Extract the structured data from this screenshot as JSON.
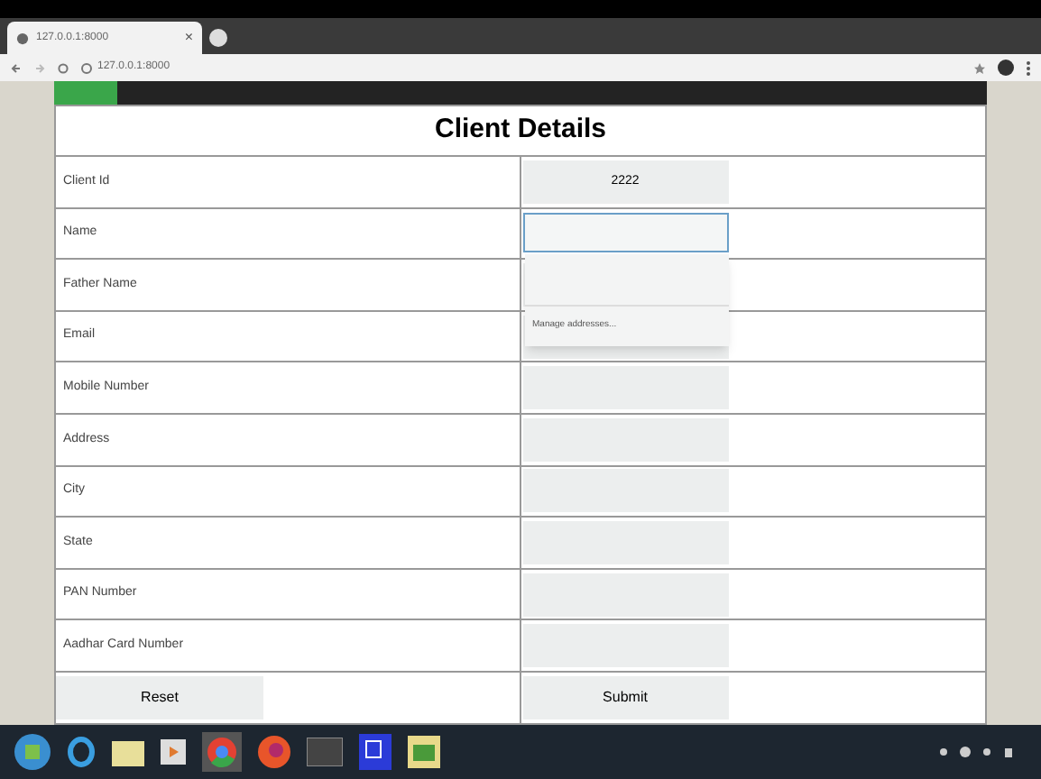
{
  "browser": {
    "tab_title": "127.0.0.1:8000",
    "tab_close": "×",
    "url": "127.0.0.1:8000"
  },
  "form": {
    "title": "Client Details",
    "fields": [
      {
        "label": "Client Id",
        "value": "2222",
        "focused": false
      },
      {
        "label": "Name",
        "focused": true
      },
      {
        "label": "Father Name",
        "focused": false
      },
      {
        "label": "Email",
        "focused": false
      },
      {
        "label": "Mobile Number",
        "focused": false
      },
      {
        "label": "Address",
        "focused": false
      },
      {
        "label": "City",
        "focused": false
      },
      {
        "label": "State",
        "focused": false
      },
      {
        "label": "PAN Number",
        "focused": false
      },
      {
        "label": "Aadhar Card Number",
        "focused": false
      }
    ],
    "autofill": {
      "manage": "Manage addresses..."
    },
    "buttons": [
      "Reset",
      "Submit"
    ]
  }
}
